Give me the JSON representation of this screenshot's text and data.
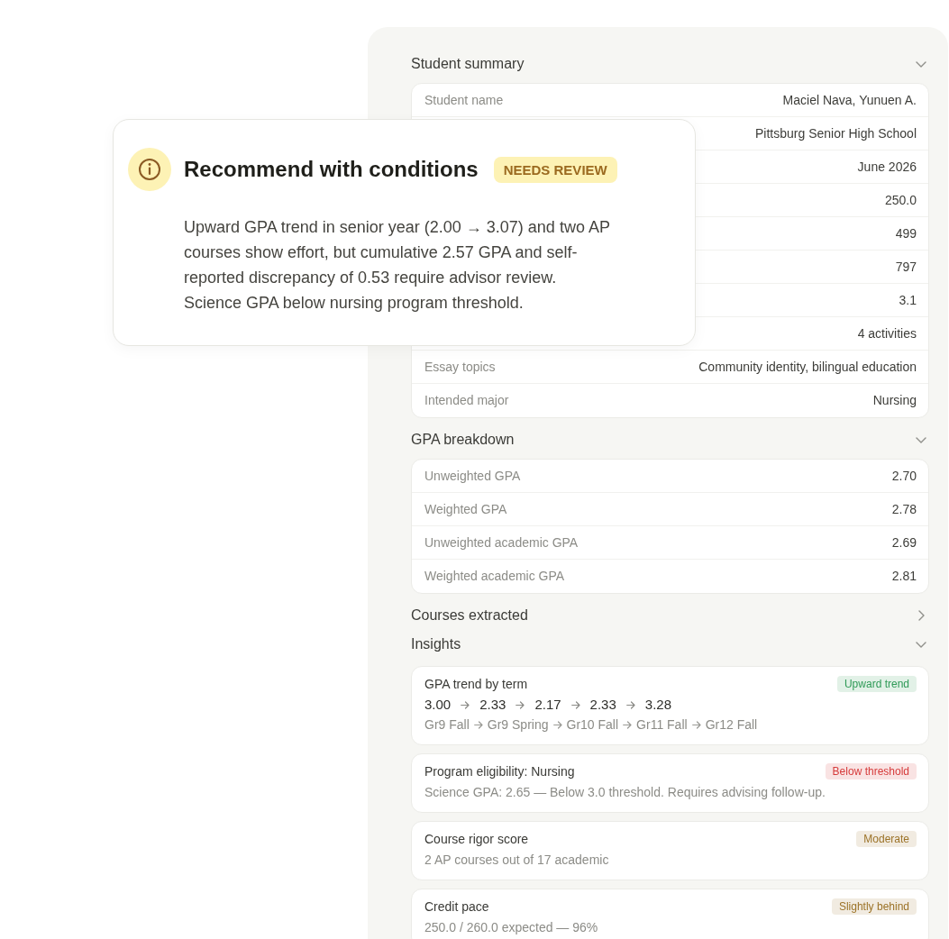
{
  "recommendation": {
    "title": "Recommend with conditions",
    "badge": "NEEDS REVIEW",
    "body": "Upward GPA trend in senior year (2.00 → 3.07) and two AP courses show effort, but cumulative 2.57 GPA and self-reported discrepancy of 0.53 require advisor review. Science GPA below nursing program threshold."
  },
  "sections": [
    {
      "kind": "fields",
      "title": "Student summary",
      "expanded": true,
      "rows": [
        {
          "label": "Student name",
          "value": "Maciel Nava, Yunuen A."
        },
        {
          "value": "Pittsburg Senior High School"
        },
        {
          "value": "June 2026"
        },
        {
          "value": "250.0"
        },
        {
          "value": "499"
        },
        {
          "value": "797"
        },
        {
          "value": "3.1"
        },
        {
          "value": "4 activities"
        },
        {
          "label": "Essay topics",
          "value": "Community identity, bilingual education"
        },
        {
          "label": "Intended major",
          "value": "Nursing"
        }
      ]
    },
    {
      "kind": "fields",
      "title": "GPA breakdown",
      "expanded": true,
      "rows": [
        {
          "label": "Unweighted GPA",
          "value": "2.70"
        },
        {
          "label": "Weighted GPA",
          "value": "2.78"
        },
        {
          "label": "Unweighted academic GPA",
          "value": "2.69"
        },
        {
          "label": "Weighted academic GPA",
          "value": "2.81"
        }
      ]
    },
    {
      "title": "Courses extracted",
      "expanded": false
    },
    {
      "kind": "insights",
      "title": "Insights",
      "expanded": true,
      "items": [
        {
          "kind": "trend",
          "title": "GPA trend by term",
          "badge": "Upward trend",
          "color": "#2f9a57",
          "values": [
            "3.00",
            "2.33",
            "2.17",
            "2.33",
            "3.28"
          ],
          "terms": [
            "Gr9 Fall",
            "Gr9 Spring",
            "Gr10 Fall",
            "Gr11 Fall",
            "Gr12 Fall"
          ]
        },
        {
          "kind": "text",
          "title": "Program eligibility: Nursing",
          "badge": "Below threshold",
          "color": "#d63b3b",
          "detail": "Science GPA: 2.65 — Below 3.0 threshold. Requires advising follow-up."
        },
        {
          "kind": "text",
          "title": "Course rigor score",
          "badge": "Moderate",
          "color": "#9c7328",
          "detail": "2 AP courses out of 17 academic"
        },
        {
          "kind": "text",
          "title": "Credit pace",
          "badge": "Slightly behind",
          "color": "#9c7328",
          "detail": "250.0 / 260.0 expected — 96%"
        }
      ]
    }
  ]
}
